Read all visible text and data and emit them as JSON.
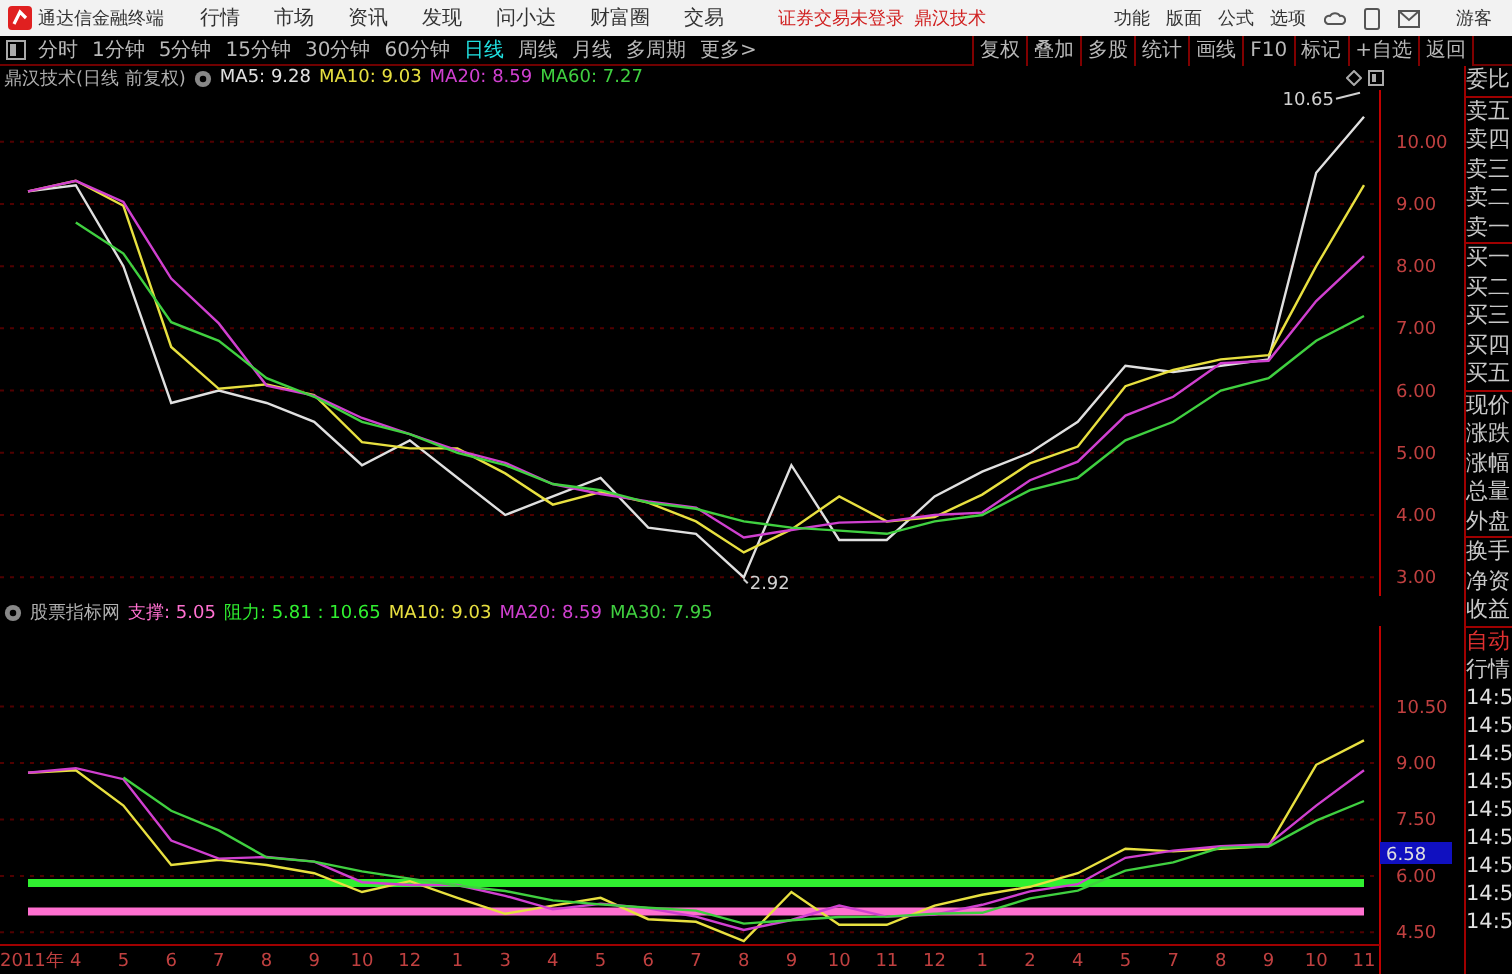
{
  "menu_bar": {
    "app_title": "通达信金融终端",
    "items": [
      "行情",
      "市场",
      "资讯",
      "发现",
      "问小达",
      "财富圈",
      "交易"
    ],
    "login_notice": "证券交易未登录",
    "stock_name": "鼎汉技术",
    "right_items": [
      "功能",
      "版面",
      "公式",
      "选项"
    ],
    "user": "游客"
  },
  "period_tabs": [
    {
      "label": "分时",
      "selected": false
    },
    {
      "label": "1分钟",
      "selected": false
    },
    {
      "label": "5分钟",
      "selected": false
    },
    {
      "label": "15分钟",
      "selected": false
    },
    {
      "label": "30分钟",
      "selected": false
    },
    {
      "label": "60分钟",
      "selected": false
    },
    {
      "label": "日线",
      "selected": true
    },
    {
      "label": "周线",
      "selected": false
    },
    {
      "label": "月线",
      "selected": false
    },
    {
      "label": "多周期",
      "selected": false
    },
    {
      "label": "更多>",
      "selected": false
    }
  ],
  "tool_buttons": [
    "复权",
    "叠加",
    "多股",
    "统计",
    "画线",
    "F10",
    "标记",
    "+自选",
    "返回"
  ],
  "price_chart": {
    "title": "鼎汉技术(日线 前复权)",
    "legend_values": [
      ": 9.28",
      ": 9.03",
      ": 8.59",
      ": 7.27"
    ],
    "chart_data": {
      "type": "line",
      "grid": true,
      "ylim": [
        2.7,
        10.83
      ],
      "yticks": [
        {
          "value": 10,
          "label": "10.00"
        },
        {
          "value": 9,
          "label": "9.00"
        },
        {
          "value": 8,
          "label": "8.00"
        },
        {
          "value": 7,
          "label": "7.00"
        },
        {
          "value": 6,
          "label": "6.00"
        },
        {
          "value": 5,
          "label": "5.00"
        },
        {
          "value": 4,
          "label": "4.00"
        },
        {
          "value": 3,
          "label": "3.00"
        }
      ],
      "series": [
        {
          "name": "MA5",
          "color": "#e0e0e0",
          "values": [
            9.2,
            9.3,
            8.0,
            5.8,
            6.0,
            5.8,
            5.5,
            4.8,
            5.2,
            4.6,
            4.0,
            4.3,
            4.6,
            3.8,
            3.7,
            3.0,
            4.8,
            3.6,
            3.6,
            4.3,
            4.7,
            5.0,
            5.5,
            6.4,
            6.3,
            6.4,
            6.5,
            9.5,
            10.4
          ]
        },
        {
          "name": "MA10",
          "color": "#e8e040",
          "values": [
            9.2,
            9.37,
            8.97,
            6.7,
            6.03,
            6.1,
            5.93,
            5.17,
            5.07,
            5.07,
            4.67,
            4.17,
            4.37,
            4.2,
            3.9,
            3.4,
            3.77,
            4.3,
            3.9,
            3.97,
            4.33,
            4.83,
            5.1,
            6.07,
            6.33,
            6.5,
            6.57,
            8.0,
            9.3
          ]
        },
        {
          "name": "MA20",
          "color": "#d040d0",
          "values": [
            9.2,
            9.37,
            9.03,
            7.8,
            7.08,
            6.08,
            5.92,
            5.56,
            5.3,
            5.04,
            4.84,
            4.5,
            4.34,
            4.22,
            4.12,
            3.64,
            3.76,
            3.88,
            3.9,
            4.0,
            4.04,
            4.56,
            4.86,
            5.6,
            5.9,
            6.44,
            6.48,
            7.44,
            8.16
          ]
        },
        {
          "name": "MA60",
          "color": "#40d040",
          "values": [
            null,
            8.7,
            8.2,
            7.1,
            6.8,
            6.2,
            5.9,
            5.5,
            5.3,
            5.0,
            4.8,
            4.5,
            4.4,
            4.2,
            4.1,
            3.9,
            3.8,
            3.75,
            3.7,
            3.9,
            4.0,
            4.4,
            4.6,
            5.2,
            5.5,
            6.0,
            6.2,
            6.8,
            7.2
          ]
        }
      ],
      "annotations": [
        "10.65",
        "2.92"
      ]
    }
  },
  "indicator_chart": {
    "title": "股票指标网",
    "current_value": "6.58",
    "legend_values": [
      ": 5.05",
      ": 5.81 : 10.65",
      ": 9.03",
      ": 8.59",
      ": 7.95"
    ],
    "chart_data": {
      "type": "line",
      "grid": true,
      "categories": [
        "2011年",
        "4",
        "5",
        "6",
        "7",
        "8",
        "9",
        "10",
        "12",
        "1",
        "3",
        "4",
        "5",
        "6",
        "7",
        "8",
        "9",
        "10",
        "11",
        "12",
        "1",
        "2",
        "4",
        "5",
        "7",
        "8",
        "9",
        "10",
        "11"
      ],
      "ylim": [
        4.19,
        12.64
      ],
      "yticks": [
        {
          "value": 10.5,
          "label": "10.50"
        },
        {
          "value": 9,
          "label": "9.00"
        },
        {
          "value": 7.5,
          "label": "7.50"
        },
        {
          "value": 6,
          "label": "6.00"
        },
        {
          "value": 4.5,
          "label": "4.50"
        }
      ],
      "series": [
        {
          "name": "支撑",
          "color": "#ff70d0",
          "values": [
            5.05,
            5.05,
            5.05,
            5.05,
            5.05,
            5.05,
            5.05,
            5.05,
            5.05,
            5.05,
            5.05,
            5.05,
            5.05,
            5.05,
            5.05,
            5.05,
            5.05,
            5.05,
            5.05,
            5.05,
            5.05,
            5.05,
            5.05,
            5.05,
            5.05,
            5.05,
            5.05,
            5.05,
            5.05
          ]
        },
        {
          "name": "阻力",
          "color": "#30f030",
          "values": [
            5.81,
            5.81,
            5.81,
            5.81,
            5.81,
            5.81,
            5.81,
            5.81,
            5.81,
            5.81,
            5.81,
            5.81,
            5.81,
            5.81,
            5.81,
            5.81,
            5.81,
            5.81,
            5.81,
            5.81,
            5.81,
            5.81,
            5.81,
            5.81,
            5.81,
            5.81,
            5.81,
            5.81,
            5.81
          ]
        },
        {
          "name": "MA10",
          "color": "#e8e040",
          "values": [
            8.74,
            8.81,
            7.87,
            6.29,
            6.43,
            6.29,
            6.07,
            5.57,
            5.86,
            5.42,
            4.99,
            5.21,
            5.42,
            4.85,
            4.78,
            4.27,
            5.57,
            4.7,
            4.7,
            5.21,
            5.5,
            5.71,
            6.07,
            6.72,
            6.65,
            6.72,
            6.79,
            8.95,
            9.6
          ]
        },
        {
          "name": "MA20",
          "color": "#d040d0",
          "values": [
            8.74,
            8.86,
            8.57,
            6.94,
            6.46,
            6.5,
            6.38,
            5.83,
            5.76,
            5.76,
            5.47,
            5.11,
            5.26,
            5.14,
            4.92,
            4.56,
            4.83,
            5.21,
            4.92,
            4.97,
            5.23,
            5.59,
            5.78,
            6.48,
            6.67,
            6.79,
            6.84,
            7.87,
            8.81
          ]
        },
        {
          "name": "MA30",
          "color": "#40d040",
          "values": [
            null,
            null,
            8.61,
            7.73,
            7.21,
            6.49,
            6.38,
            6.12,
            5.93,
            5.74,
            5.6,
            5.35,
            5.24,
            5.15,
            5.08,
            4.73,
            4.82,
            4.91,
            4.92,
            4.99,
            5.02,
            5.4,
            5.61,
            6.14,
            6.36,
            6.75,
            6.78,
            7.47,
            7.99
          ]
        }
      ]
    }
  },
  "quote_panel": {
    "groups": [
      [
        "委比"
      ],
      [
        "卖五",
        "卖四",
        "卖三",
        "卖二",
        "卖一"
      ],
      [
        "买一",
        "买二",
        "买三",
        "买四",
        "买五"
      ],
      [
        "现价",
        "涨跌",
        "涨幅",
        "总量",
        "外盘"
      ],
      [
        "换手",
        "净资",
        "收益"
      ]
    ],
    "mode": "自动",
    "title": "行情",
    "times": [
      "14:5",
      "14:5",
      "14:5",
      "14:5",
      "14:5",
      "14:5",
      "14:5",
      "14:5",
      "14:5"
    ]
  }
}
